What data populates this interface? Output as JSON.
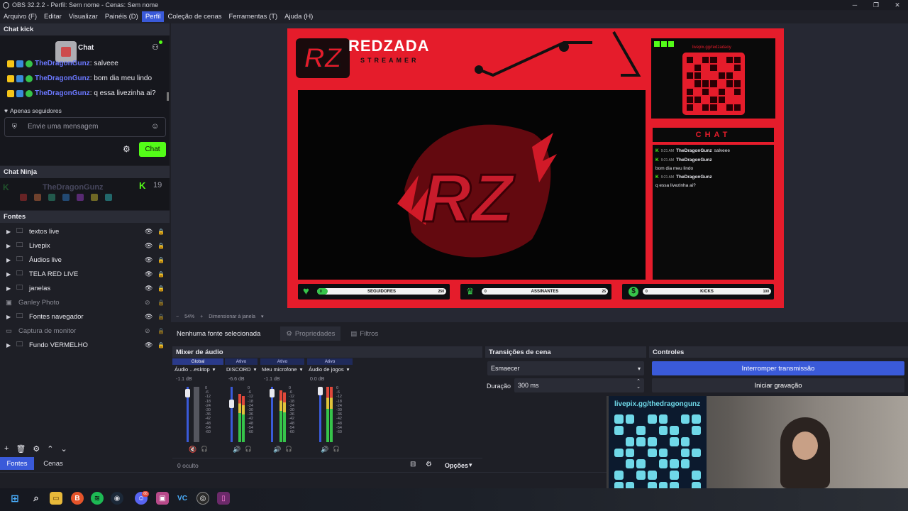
{
  "window": {
    "title": "OBS 32.2.2 - Perfil: Sem nome - Cenas: Sem nome"
  },
  "menu": [
    "Arquivo (F)",
    "Editar",
    "Visualizar",
    "Painéis (D)",
    "Perfil",
    "Coleção de cenas",
    "Ferramentas (T)",
    "Ajuda (H)"
  ],
  "chat_kick": {
    "title": "Chat kick",
    "header_label": "Chat",
    "messages": [
      {
        "user": "TheDragonGunz",
        "text": ": salveee"
      },
      {
        "user": "TheDragonGunz",
        "text": ": bom dia meu lindo"
      },
      {
        "user": "TheDragonGunz",
        "text": ": q essa livezinha ai?"
      }
    ],
    "followers_only": "Apenas seguidores",
    "input_placeholder": "Envie uma mensagem",
    "send_label": "Chat"
  },
  "chat_ninja": {
    "title": "Chat Ninja",
    "overflow_user": "TheDragonGunz",
    "count": "19"
  },
  "sources": {
    "title": "Fontes",
    "items": [
      {
        "label": "textos live",
        "group": true,
        "visible": true
      },
      {
        "label": "Livepix",
        "group": true,
        "visible": true
      },
      {
        "label": "Áudios live",
        "group": true,
        "visible": true
      },
      {
        "label": "TELA RED LIVE",
        "group": true,
        "visible": true
      },
      {
        "label": "janelas",
        "group": true,
        "visible": true
      },
      {
        "label": "Ganley Photo",
        "group": false,
        "visible": false
      },
      {
        "label": "Fontes navegador",
        "group": true,
        "visible": true
      },
      {
        "label": "Captura de monitor",
        "group": false,
        "visible": false
      },
      {
        "label": "Fundo VERMELHO",
        "group": true,
        "visible": true
      }
    ]
  },
  "bottom_tabs": [
    "Fontes",
    "Cenas"
  ],
  "preview": {
    "brand": "REDZADA",
    "brand_sub": "STREAMER",
    "logo": "RZ",
    "chat_title": "CHAT",
    "qr_url_small": "livepix.gg/redzadaoy",
    "overlay_chat": [
      {
        "time": "9:21 AM",
        "user": "TheDragonGunz",
        "text": "salveee"
      },
      {
        "time": "9:21 AM",
        "user": "TheDragonGunz",
        "text": "bom dia meu lindo"
      },
      {
        "time": "9:21 AM",
        "user": "TheDragonGunz",
        "text": "q essa livezinha ai?"
      }
    ],
    "stats": [
      {
        "label": "SEGUIDORES",
        "current": "0",
        "goal": "250",
        "progress": 0.08
      },
      {
        "label": "ASSINANTES",
        "current": "0",
        "goal": "25",
        "progress": 0.0
      },
      {
        "label": "KICKS",
        "current": "0",
        "goal": "100",
        "progress": 0.0
      }
    ],
    "zoom": "54%",
    "fit_label": "Dimensionar à janela"
  },
  "source_toolbar": {
    "no_source": "Nenhuma fonte selecionada",
    "properties": "Propriedades",
    "filters": "Filtros"
  },
  "mixer": {
    "title": "Mixer de áudio",
    "channels": [
      {
        "tag": "Global",
        "name": "Áudio ...esktop",
        "db": "-1.1 dB",
        "muted": true,
        "level": 0.0
      },
      {
        "tag": "Ativo",
        "name": "DISCORD",
        "db": "-6.6 dB",
        "muted": false,
        "level": 0.55
      },
      {
        "tag": "Ativo",
        "name": "Meu microfone",
        "db": "-1.1 dB",
        "muted": false,
        "level": 0.65
      },
      {
        "tag": "Ativo",
        "name": "Áudio de jogos",
        "db": "0.0 dB",
        "muted": false,
        "level": 0.6
      }
    ],
    "scale": [
      "0",
      "-6",
      "-12",
      "-18",
      "-24",
      "-30",
      "-36",
      "-42",
      "-48",
      "-54",
      "-60"
    ],
    "hidden": "0 oculto",
    "options": "Opções"
  },
  "transitions": {
    "title": "Transições de cena",
    "type": "Esmaecer",
    "duration_label": "Duração",
    "duration": "300 ms"
  },
  "controls": {
    "title": "Controles",
    "stop_stream": "Interromper transmissão",
    "start_record": "Iniciar gravação"
  },
  "webcam_overlay": {
    "url": "livepix.gg/thedragongunz"
  },
  "taskbar": {
    "apps": [
      "windows",
      "search",
      "explorer",
      "brave",
      "spotify",
      "steam",
      "discord",
      "app",
      "vscode",
      "obs",
      "app2"
    ],
    "discord_badge": "66"
  },
  "colors": {
    "accent": "#3a5ad9",
    "kick_green": "#53fc18",
    "brand_red": "#e51c2b"
  }
}
